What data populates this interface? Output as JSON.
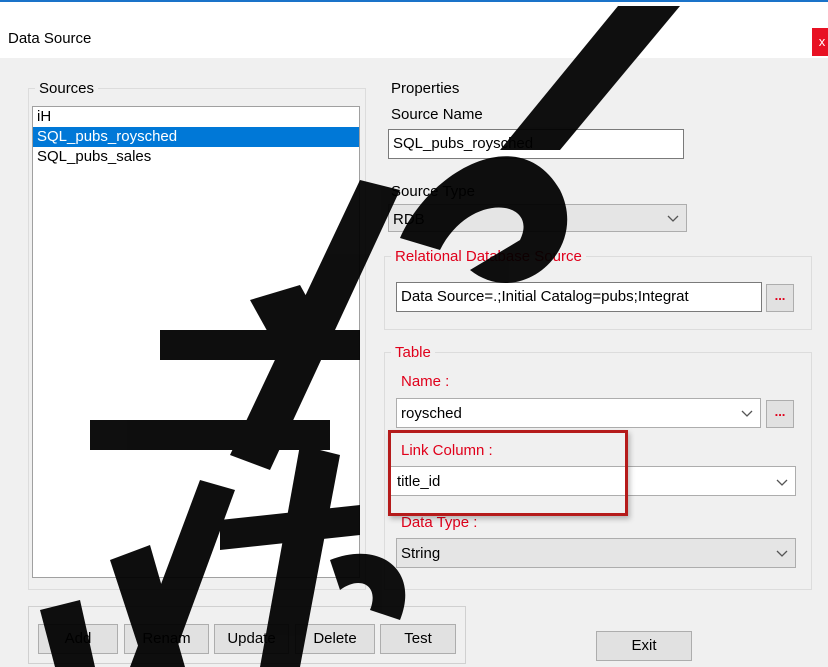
{
  "window": {
    "title": "Data Source",
    "close_glyph": "x"
  },
  "sources": {
    "group_label": "Sources",
    "items": [
      {
        "label": "iH",
        "selected": false
      },
      {
        "label": "SQL_pubs_roysched",
        "selected": true
      },
      {
        "label": "SQL_pubs_sales",
        "selected": false
      }
    ]
  },
  "properties": {
    "group_label": "Properties",
    "source_name_label": "Source Name",
    "source_name_value": "SQL_pubs_roysched",
    "source_type_label": "Source Type",
    "source_type_value": "RDB",
    "rdb_group_label": "Relational Database Source",
    "connection_string": "Data Source=.;Initial Catalog=pubs;Integrat",
    "browse_glyph": "...",
    "table": {
      "group_label": "Table",
      "name_label": "Name :",
      "name_value": "roysched",
      "link_column_label": "Link Column :",
      "link_column_value": "title_id",
      "data_type_label": "Data Type :",
      "data_type_value": "String"
    }
  },
  "buttons": {
    "add": "Add",
    "rename": "Renam",
    "update": "Update",
    "delete": "Delete",
    "test": "Test",
    "exit": "Exit"
  },
  "colors": {
    "accent": "#0078d7",
    "label_red": "#e0001b",
    "highlight": "#b51b1b"
  }
}
